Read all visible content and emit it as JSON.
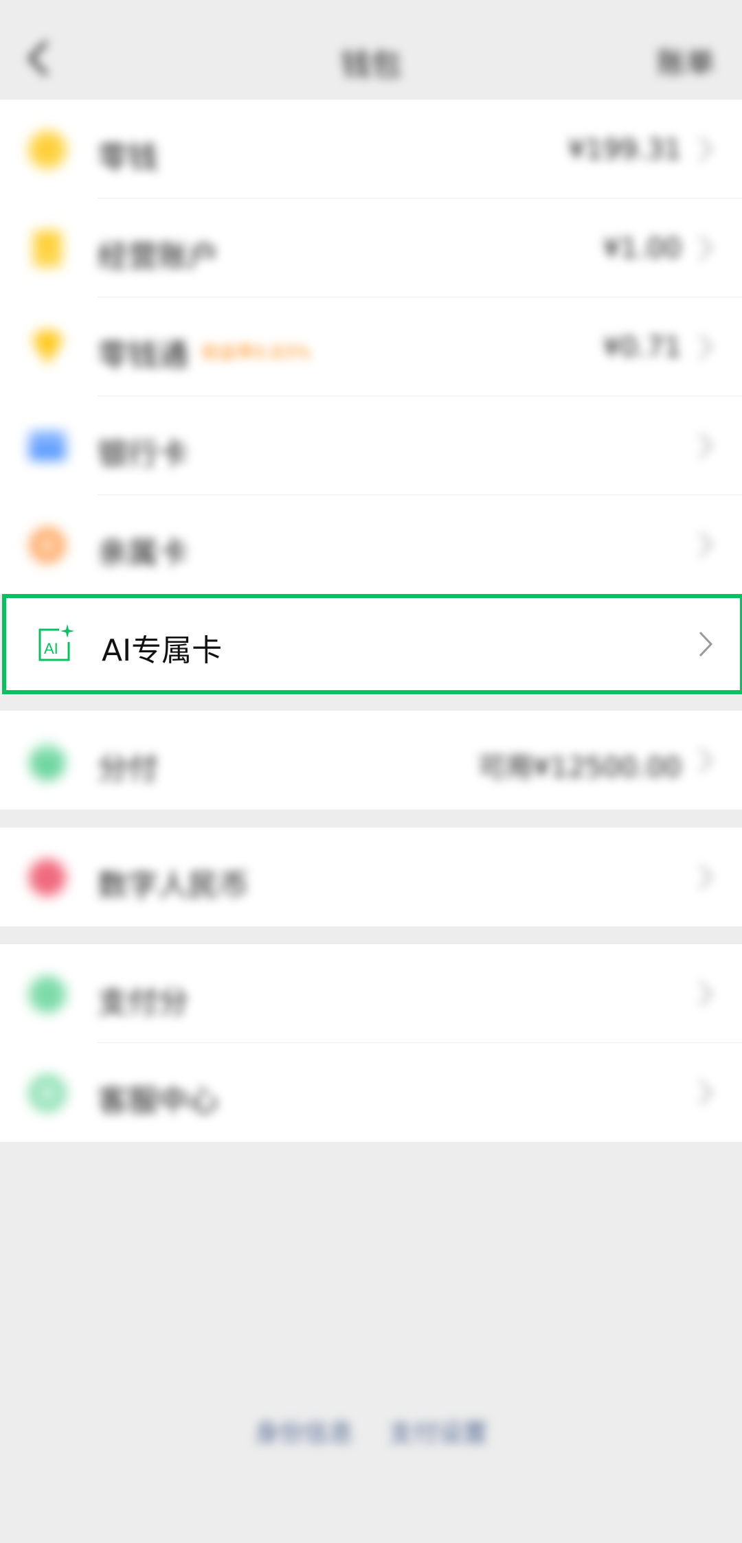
{
  "navbar": {
    "title": "钱包",
    "right_label": "账单"
  },
  "group1": {
    "items": [
      {
        "label": "零钱",
        "value": "¥199.31",
        "icon": "coin-icon"
      },
      {
        "label": "经营账户",
        "value": "¥1.00",
        "icon": "document-icon"
      },
      {
        "label": "零钱通",
        "badge": "收益率0.83%",
        "value": "¥0.71",
        "icon": "diamond-icon"
      },
      {
        "label": "银行卡",
        "value": "",
        "icon": "bank-card-icon"
      },
      {
        "label": "亲属卡",
        "value": "",
        "icon": "family-card-icon"
      }
    ]
  },
  "ai_card": {
    "label": "AI专属卡",
    "icon": "ai-sparkle-icon",
    "highlight_color": "#07c160"
  },
  "group2": {
    "items": [
      {
        "label": "分付",
        "value": "可用¥12500.00",
        "icon": "fenfu-icon"
      }
    ]
  },
  "group3": {
    "items": [
      {
        "label": "数字人民币",
        "value": "",
        "icon": "digital-rmb-icon"
      }
    ]
  },
  "group4": {
    "items": [
      {
        "label": "支付分",
        "value": "",
        "icon": "pay-score-icon"
      },
      {
        "label": "客服中心",
        "value": "",
        "icon": "service-icon"
      }
    ]
  },
  "footer": {
    "link1": "身份信息",
    "link2": "支付设置"
  },
  "colors": {
    "accent": "#07c160",
    "link": "#576b95",
    "badge": "#ff8f1f"
  }
}
